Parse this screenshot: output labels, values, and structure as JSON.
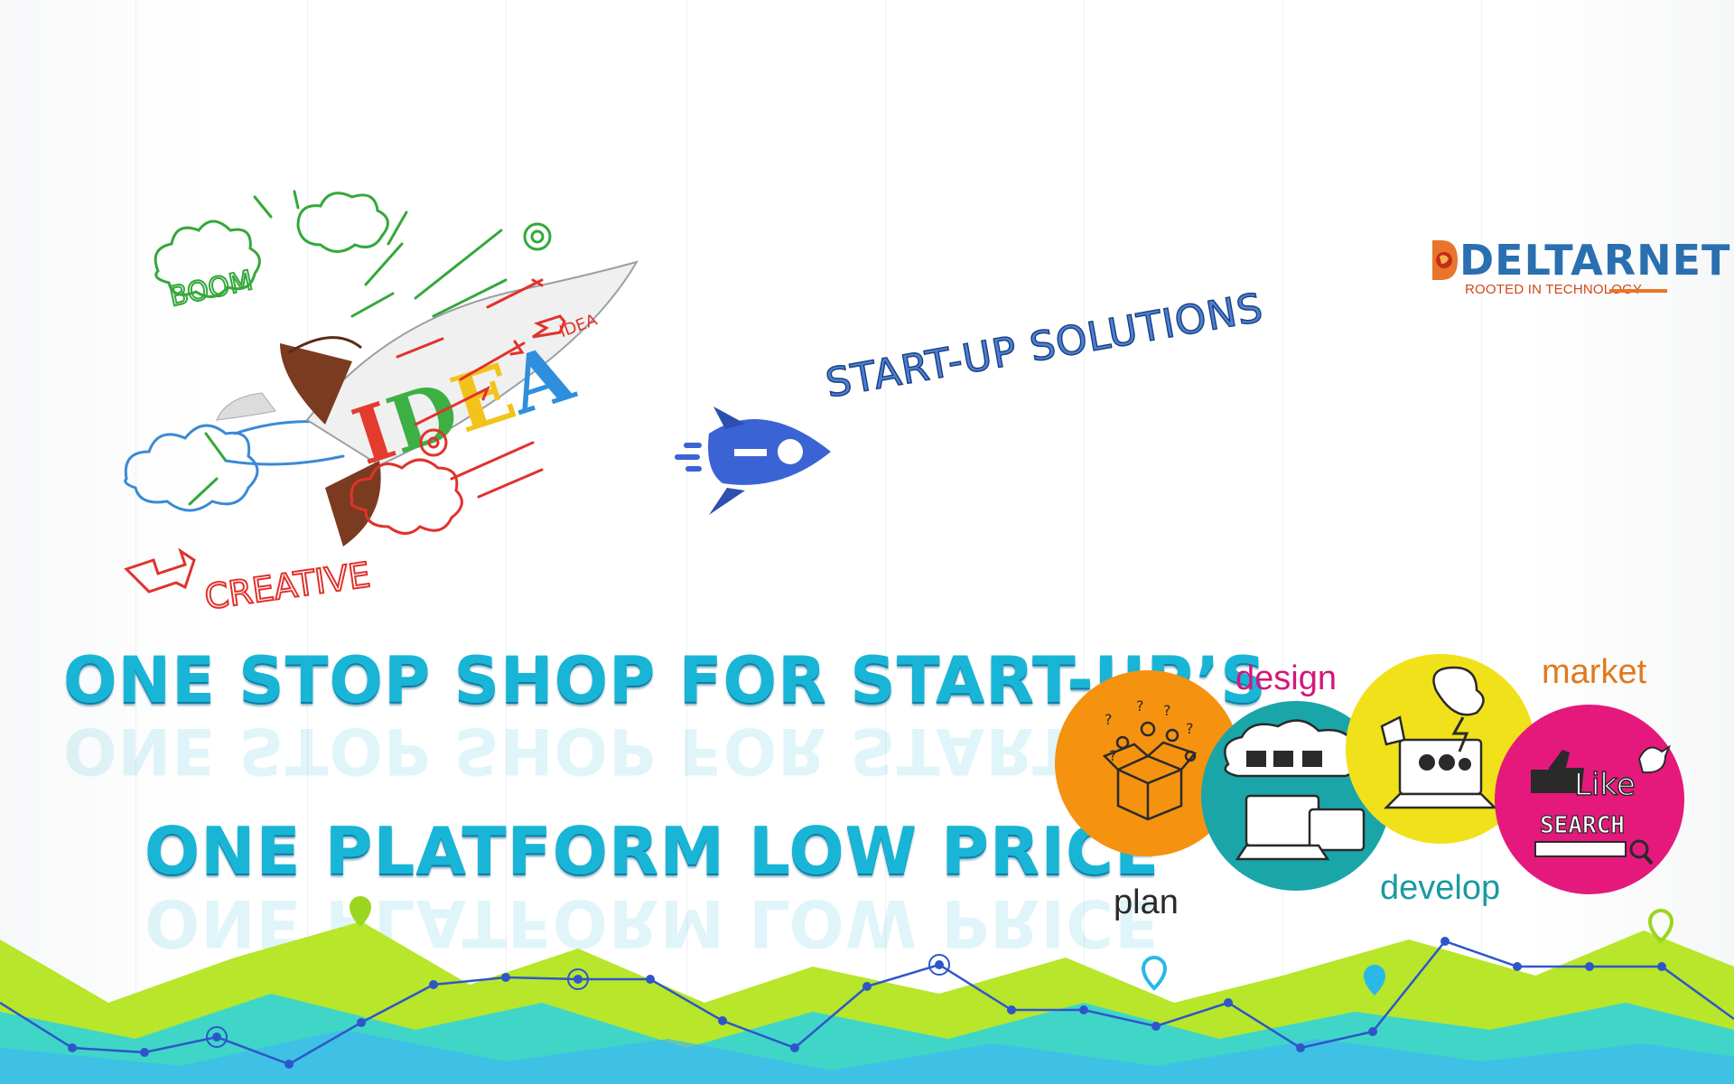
{
  "brand": {
    "logo_text": "DELTARNET",
    "tagline": "ROOTED IN TECHNOLOGY"
  },
  "banner": {
    "title": "START-UP SOLUTIONS",
    "headline_1": "ONE STOP SHOP FOR START-UP’S",
    "headline_2": "ONE PLATFORM LOW PRICE"
  },
  "illustration": {
    "rocket_word": "IDEA",
    "sketch_words": [
      "BOOM",
      "IDEA",
      "CREATIVE"
    ]
  },
  "steps": [
    {
      "label": "plan",
      "color": "#f5920f",
      "icon": "idea-box-icon"
    },
    {
      "label": "design",
      "color": "#1aa6a8",
      "icon": "devices-icon"
    },
    {
      "label": "develop",
      "color": "#f1e11a",
      "icon": "laptop-gears-icon"
    },
    {
      "label": "market",
      "color": "#e5197c",
      "icon": "like-search-icon"
    }
  ],
  "step_marks": {
    "search_word": "SEARCH",
    "like_word": "Like"
  },
  "colors": {
    "headline": "#19b5d6",
    "brand_blue": "#2a6fb0",
    "brand_orange": "#e8752a",
    "wave_green": "#b8e62a",
    "wave_teal": "#3fd6c8",
    "wave_blue": "#3fb8f0",
    "line_blue": "#2f56c9"
  }
}
